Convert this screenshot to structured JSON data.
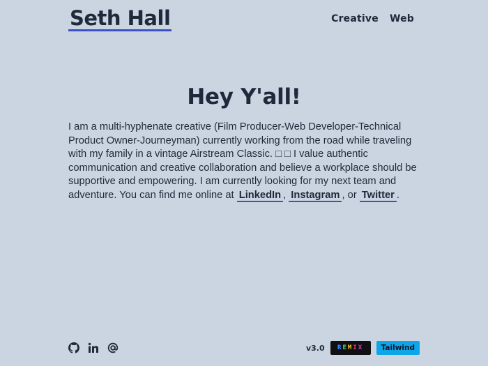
{
  "header": {
    "title": "Seth Hall",
    "nav": [
      {
        "label": "Creative"
      },
      {
        "label": "Web"
      }
    ]
  },
  "main": {
    "headline": "Hey Y'all!",
    "bio_part1": "I am a multi-hyphenate creative (Film Producer-Web Developer-Technical Product Owner-Journeyman) currently working from the road while traveling with my family in a vintage Airstream Classic. □ □ I value authentic communication and creative collaboration and believe a workplace should be supportive and empowering. I am currently looking for my next team and adventure. You can find me online at ",
    "links": {
      "linkedin": "LinkedIn",
      "instagram": "Instagram",
      "twitter": "Twitter"
    },
    "sep1": ", ",
    "sep2": ", or ",
    "end": "."
  },
  "footer": {
    "social_icons": [
      "github-icon",
      "linkedin-icon",
      "at-sign-icon"
    ],
    "version": "v3.0",
    "remix_letters": [
      "R",
      "E",
      "M",
      "I",
      "X"
    ],
    "tailwind_label": "Tailwind"
  },
  "colors": {
    "background": "#cbd5e1",
    "text": "#1e293b",
    "link_underline": "#3b50c4",
    "tailwind_badge": "#0ea5e9",
    "remix_badge": "#0f0f14"
  }
}
